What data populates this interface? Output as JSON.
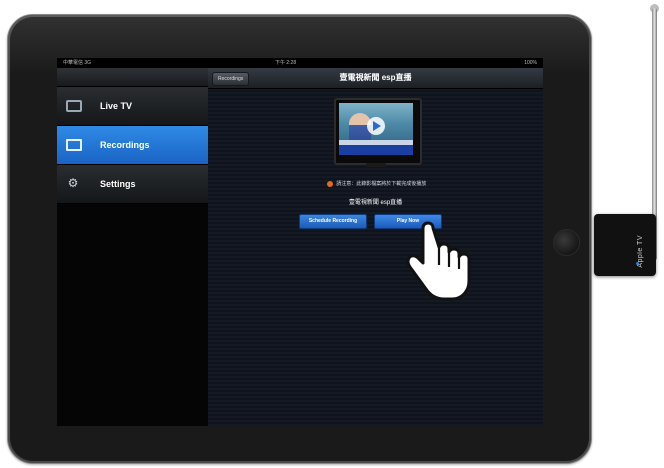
{
  "status_bar": {
    "carrier": "中華電信 3G",
    "time": "下午 2:28",
    "battery": "100%"
  },
  "device": {
    "dongle_label": "Apple TV"
  },
  "sidebar": {
    "items": [
      {
        "label": "Live TV",
        "icon": "tv-icon",
        "active": false
      },
      {
        "label": "Recordings",
        "icon": "film-icon",
        "active": true
      },
      {
        "label": "Settings",
        "icon": "gear-icon",
        "active": false
      }
    ]
  },
  "nav": {
    "back_label": "Recordings",
    "title": "壹電視新聞 esp直播"
  },
  "content": {
    "info_text": "請注意：此錄影檔案將於下載完成後播放",
    "channel_text": "壹電視新聞 esp直播",
    "schedule_button": "Schedule Recording",
    "play_button": "Play Now"
  },
  "colors": {
    "accent": "#1f6fd6",
    "active_sidebar": "#2a80de"
  }
}
